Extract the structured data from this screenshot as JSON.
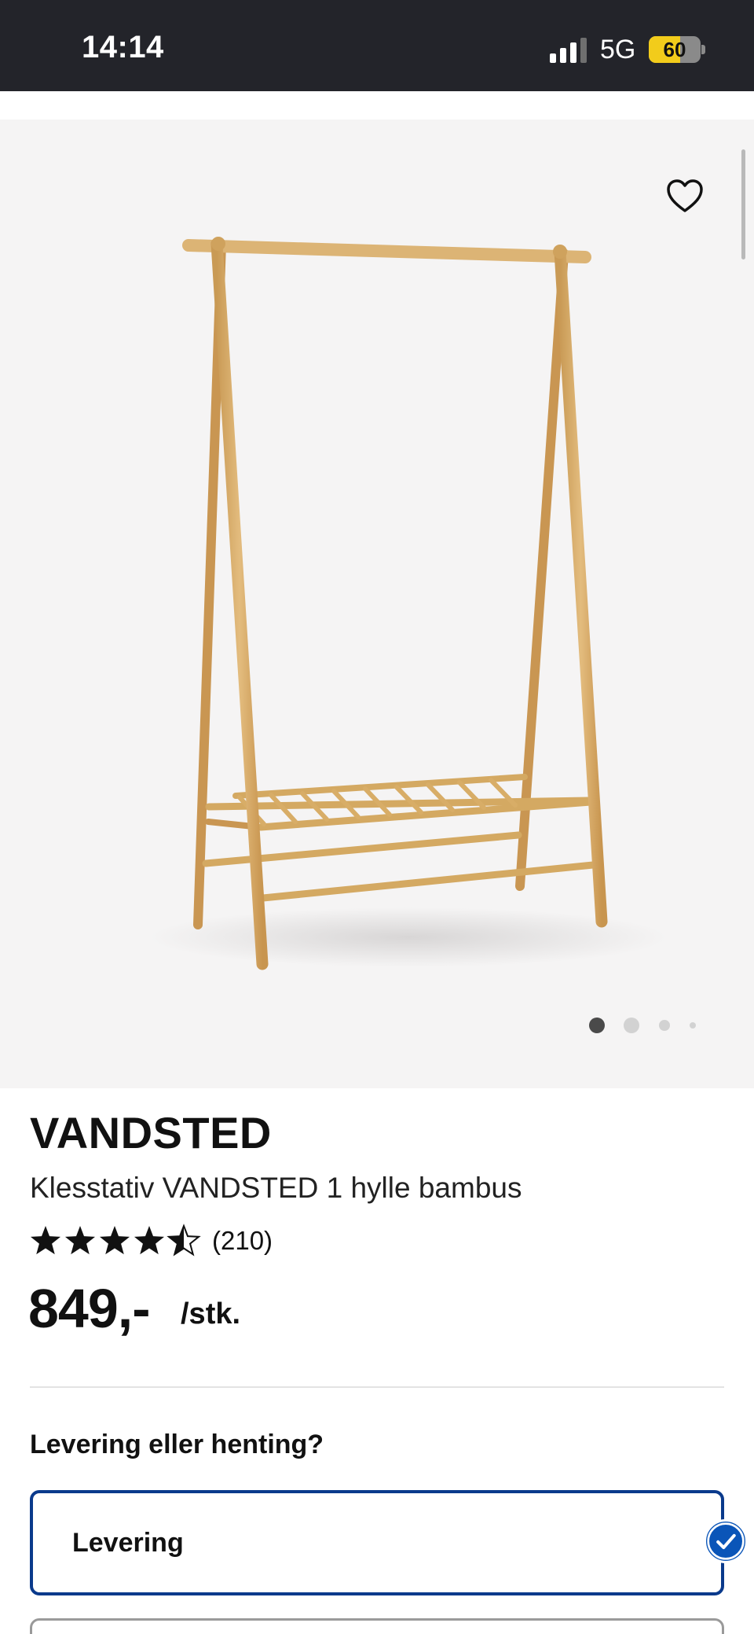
{
  "status_bar": {
    "time": "14:14",
    "network": "5G",
    "battery_percent": "60",
    "battery_level": 0.6
  },
  "gallery": {
    "image_alt": "Klesstativ VANDSTED 1 hylle bambus",
    "favorite_icon": "heart-outline-icon",
    "pagination": {
      "count": 4,
      "active_index": 0
    }
  },
  "product": {
    "brand": "VANDSTED",
    "description": "Klesstativ VANDSTED 1 hylle bambus",
    "rating": {
      "value": 4.5,
      "max": 5,
      "count_text": "(210)"
    },
    "price": "849,-",
    "unit": "/stk."
  },
  "fulfillment": {
    "title": "Levering eller henting?",
    "options": [
      {
        "label": "Levering",
        "selected": true
      }
    ]
  },
  "colors": {
    "status_bar_bg": "#23242a",
    "battery_yellow": "#f2cc1b",
    "selected_border": "#0a3a8c",
    "check_blue": "#0a55b8",
    "gallery_bg": "#f5f4f4",
    "bamboo": "#d9b06e"
  }
}
